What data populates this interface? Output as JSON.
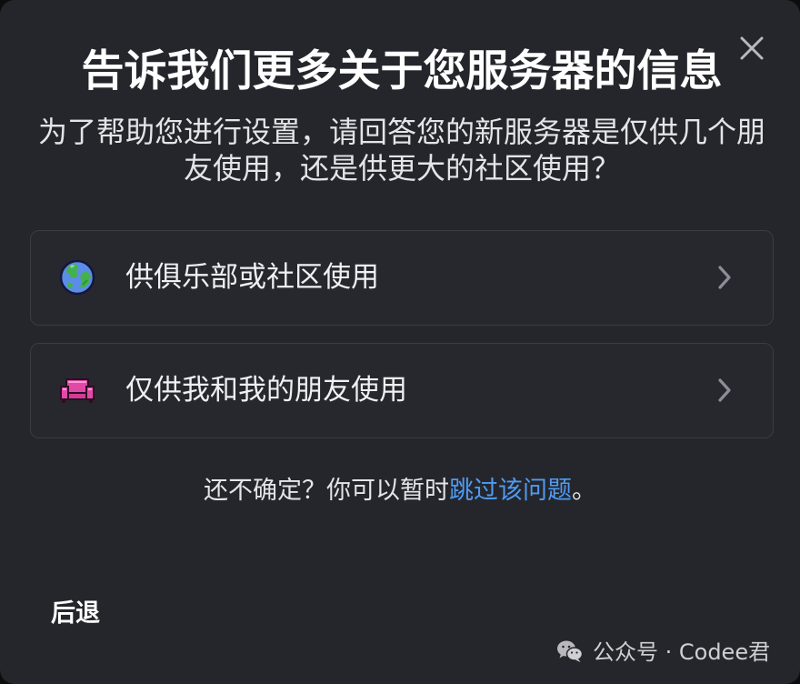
{
  "modal": {
    "title": "告诉我们更多关于您服务器的信息",
    "subtitle": "为了帮助您进行设置，请回答您的新服务器是仅供几个朋友使用，还是供更大的社区使用？",
    "close_icon": "close-icon",
    "options": [
      {
        "label": "供俱乐部或社区使用",
        "icon": "globe-icon",
        "chevron": "chevron-right-icon"
      },
      {
        "label": "仅供我和我的朋友使用",
        "icon": "couch-icon",
        "chevron": "chevron-right-icon"
      }
    ],
    "skip_prompt": {
      "before": "还不确定？你可以暂时",
      "link": "跳过该问题",
      "after": "。"
    },
    "back_label": "后退"
  },
  "watermark": {
    "icon": "wechat-icon",
    "text": "公众号 · Codee君"
  },
  "colors": {
    "background": "#25262b",
    "card_background": "#27282d",
    "card_border": "#3a3c43",
    "title": "#ffffff",
    "text": "#e3e5e8",
    "label": "#eef0f3",
    "link": "#4f9bf4",
    "icon_muted": "#b5bac1"
  }
}
